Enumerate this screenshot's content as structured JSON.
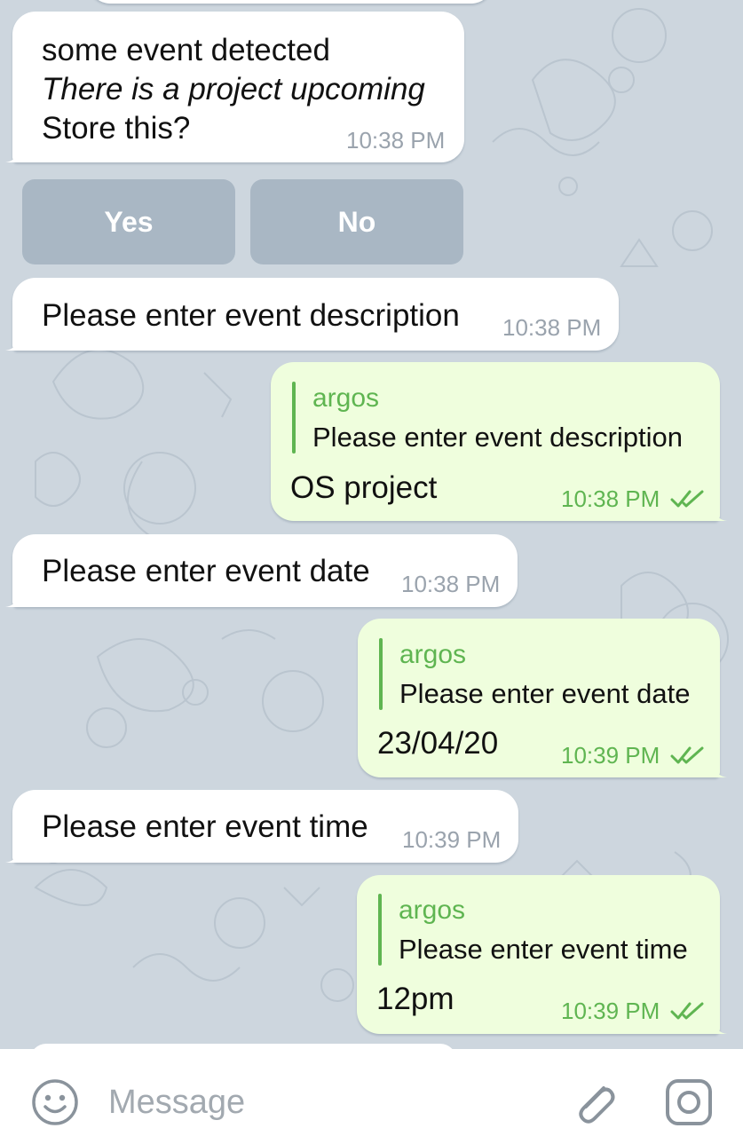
{
  "messages": [
    {
      "direction": "incoming",
      "lines": [
        "some event detected",
        "There is a project upcoming",
        "Store this?"
      ],
      "time": "10:38 PM"
    },
    {
      "direction": "incoming",
      "text": "Please enter event description",
      "time": "10:38 PM"
    },
    {
      "direction": "outgoing",
      "reply_to": {
        "name": "argos",
        "text": "Please enter event description"
      },
      "text": "OS project",
      "time": "10:38 PM",
      "status": "read"
    },
    {
      "direction": "incoming",
      "text": "Please enter event date",
      "time": "10:38 PM"
    },
    {
      "direction": "outgoing",
      "reply_to": {
        "name": "argos",
        "text": "Please enter event date"
      },
      "text": "23/04/20",
      "time": "10:39 PM",
      "status": "read"
    },
    {
      "direction": "incoming",
      "text": "Please enter event time",
      "time": "10:39 PM"
    },
    {
      "direction": "outgoing",
      "reply_to": {
        "name": "argos",
        "text": "Please enter event time"
      },
      "text": "12pm",
      "time": "10:39 PM",
      "status": "read"
    }
  ],
  "inline_keyboard": [
    "Yes",
    "No"
  ],
  "composer": {
    "placeholder": "Message",
    "icons": [
      "emoji-icon",
      "attach-icon",
      "camera-icon"
    ]
  },
  "colors": {
    "chat_background": "#cdd6de",
    "incoming_bubble": "#ffffff",
    "outgoing_bubble": "#effedd",
    "accent_green": "#5fb551",
    "timestamp_gray": "#9aa3ad"
  }
}
